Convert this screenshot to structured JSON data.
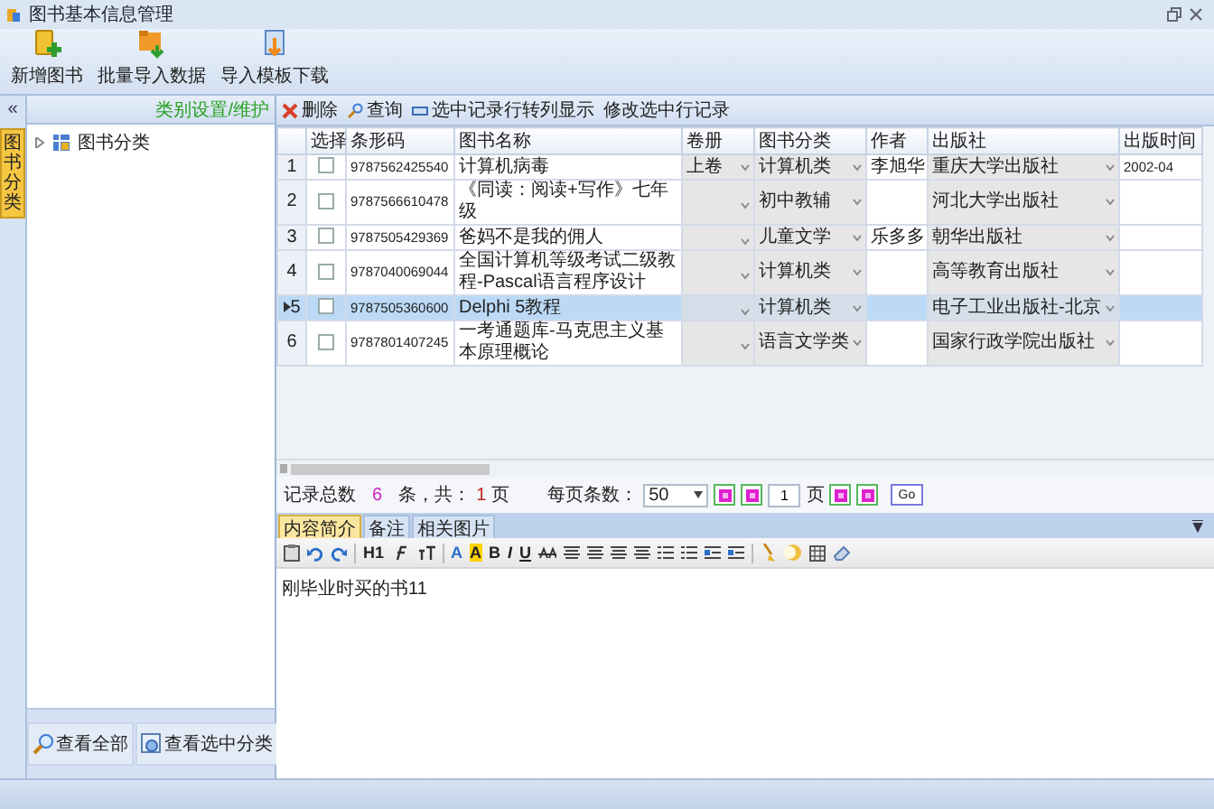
{
  "window": {
    "title": "图书基本信息管理"
  },
  "toolbar": [
    {
      "label": "新增图书",
      "kind": "add"
    },
    {
      "label": "批量导入数据",
      "kind": "import"
    },
    {
      "label": "导入模板下载",
      "kind": "download"
    }
  ],
  "left_panel": {
    "collapse": "«",
    "vertical_tab": "图书分类",
    "header_link": "类别设置/维护",
    "tree": [
      {
        "label": "图书分类",
        "expanded": false
      }
    ],
    "buttons": [
      {
        "label": "查看全部",
        "kind": "search"
      },
      {
        "label": "查看选中分类",
        "kind": "filter"
      }
    ]
  },
  "actions": [
    {
      "label": "删除",
      "kind": "delete"
    },
    {
      "label": "查询",
      "kind": "search"
    },
    {
      "label": "选中记录行转列显示",
      "kind": "transpose"
    },
    {
      "label": "修改选中行记录",
      "kind": "plain"
    }
  ],
  "table": {
    "columns": [
      "选择",
      "条形码",
      "图书名称",
      "卷册",
      "图书分类",
      "作者",
      "出版社",
      "出版时间"
    ],
    "rows": [
      {
        "num": "1",
        "selected": false,
        "checked": false,
        "barcode": "9787562425540",
        "title": "计算机病毒",
        "volume": "上卷",
        "category": "计算机类",
        "author": "李旭华",
        "publisher": "重庆大学出版社",
        "date": "2002-04"
      },
      {
        "num": "2",
        "selected": false,
        "checked": false,
        "barcode": "9787566610478",
        "title": "《同读：阅读+写作》七年级",
        "category": "初中教辅",
        "publisher": "河北大学出版社"
      },
      {
        "num": "3",
        "selected": false,
        "checked": false,
        "barcode": "9787505429369",
        "title": "爸妈不是我的佣人",
        "category": "儿童文学",
        "author": "乐多多",
        "publisher": "朝华出版社"
      },
      {
        "num": "4",
        "selected": false,
        "checked": false,
        "barcode": "9787040069044",
        "title": "全国计算机等级考试二级教程-Pascal语言程序设计",
        "category": "计算机类",
        "publisher": "高等教育出版社"
      },
      {
        "num": "5",
        "selected": true,
        "checked": false,
        "barcode": "9787505360600",
        "title": "Delphi 5教程",
        "category": "计算机类",
        "publisher": "电子工业出版社-北京"
      },
      {
        "num": "6",
        "selected": false,
        "checked": false,
        "barcode": "9787801407245",
        "title": "一考通题库-马克思主义基本原理概论",
        "category": "语言文学类",
        "publisher": "国家行政学院出版社"
      }
    ]
  },
  "pager": {
    "total_label": "记录总数",
    "total": "6",
    "total_unit": "条，共：",
    "pages": "1",
    "pages_unit": "页",
    "page_size_label": "每页条数：",
    "page_size": "50",
    "page": "1",
    "page_unit": "页",
    "go": "Go"
  },
  "editor": {
    "tabs": [
      {
        "label": "内容简介",
        "selected": true
      },
      {
        "label": "备注",
        "selected": false
      },
      {
        "label": "相关图片",
        "selected": false
      }
    ],
    "toolbar": [
      {
        "kind": "paste"
      },
      {
        "kind": "undo"
      },
      {
        "kind": "redo"
      },
      {
        "kind": "sep"
      },
      {
        "kind": "text",
        "label": "H1"
      },
      {
        "kind": "font"
      },
      {
        "kind": "size"
      },
      {
        "kind": "sep"
      },
      {
        "kind": "color",
        "label": "A"
      },
      {
        "kind": "highlight",
        "label": "A"
      },
      {
        "kind": "text",
        "label": "B"
      },
      {
        "kind": "italic",
        "label": "I"
      },
      {
        "kind": "underline",
        "label": "U"
      },
      {
        "kind": "strike"
      },
      {
        "kind": "align"
      },
      {
        "kind": "align"
      },
      {
        "kind": "align"
      },
      {
        "kind": "align"
      },
      {
        "kind": "list"
      },
      {
        "kind": "list"
      },
      {
        "kind": "indent"
      },
      {
        "kind": "indent"
      },
      {
        "kind": "sep"
      },
      {
        "kind": "brush"
      },
      {
        "kind": "image"
      },
      {
        "kind": "table"
      },
      {
        "kind": "eraser"
      }
    ],
    "content": "刚毕业时买的书11"
  }
}
